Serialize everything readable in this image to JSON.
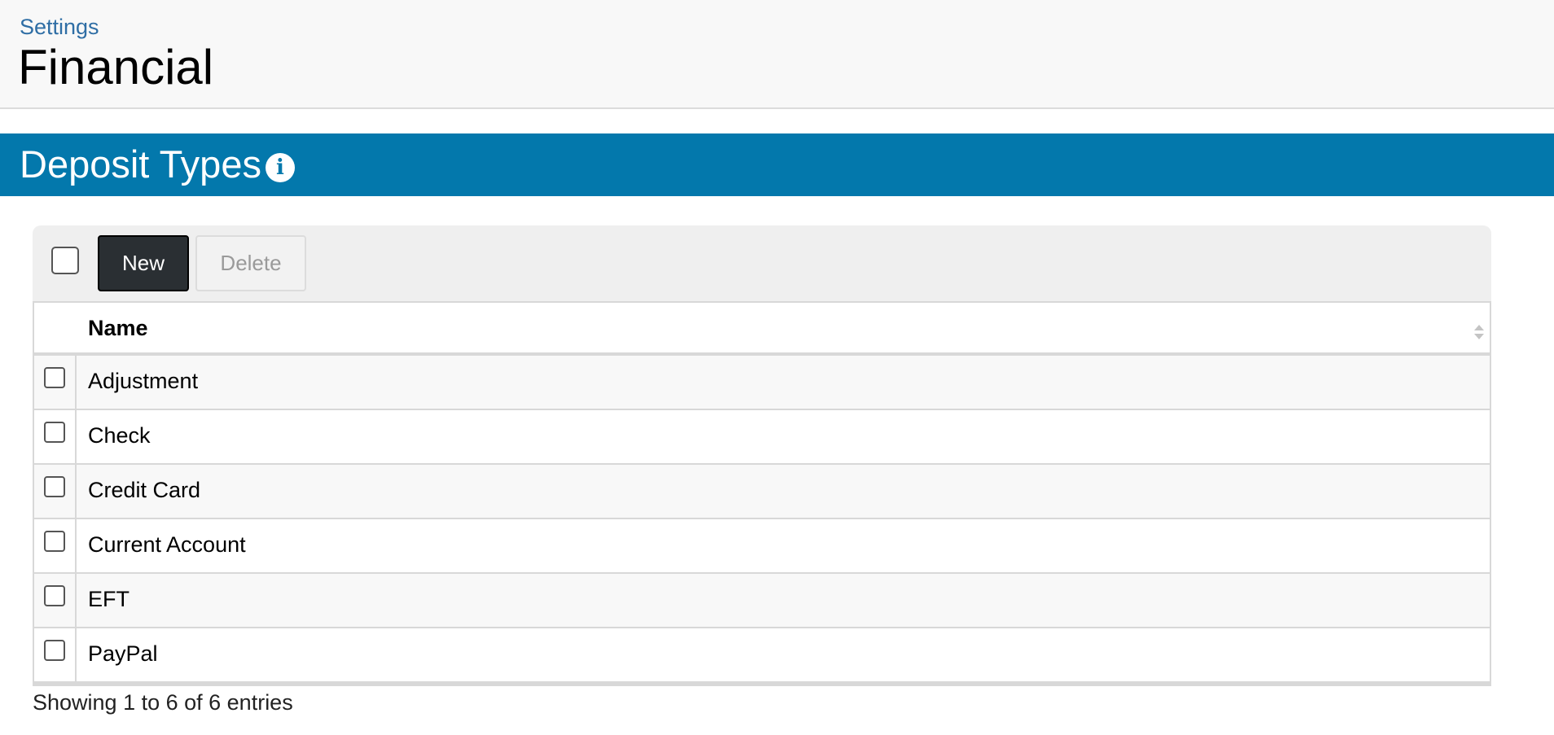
{
  "header": {
    "breadcrumb": "Settings",
    "title": "Financial"
  },
  "section": {
    "title": "Deposit Types",
    "info_icon": "info-circle-icon",
    "color": "#0378ac"
  },
  "toolbar": {
    "new_label": "New",
    "delete_label": "Delete"
  },
  "table": {
    "columns": [
      "Name"
    ],
    "rows": [
      {
        "name": "Adjustment"
      },
      {
        "name": "Check"
      },
      {
        "name": "Credit Card"
      },
      {
        "name": "Current Account"
      },
      {
        "name": "EFT"
      },
      {
        "name": "PayPal"
      }
    ]
  },
  "footer": {
    "info": "Showing 1 to 6 of 6 entries"
  },
  "colors": {
    "accent": "#0378ac",
    "link": "#2f6ea5",
    "primary_button": "#2a2f33"
  }
}
